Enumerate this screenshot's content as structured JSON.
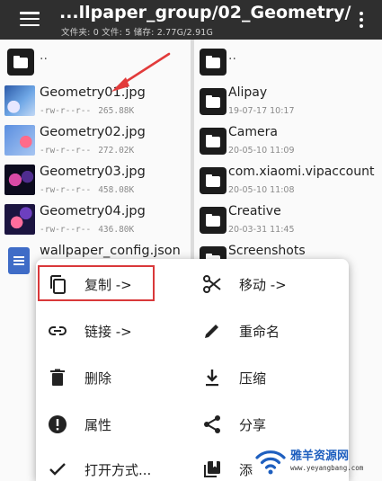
{
  "appbar": {
    "title": "...llpaper_group/02_Geometry/",
    "subtitle": "文件夹: 0   文件: 5   储存: 2.77G/2.91G"
  },
  "left_pane": {
    "parent_label": "..",
    "files": [
      {
        "name": "Geometry01.jpg",
        "perm": "-rw-r--r--",
        "size": "265.88K",
        "thumb": "t1"
      },
      {
        "name": "Geometry02.jpg",
        "perm": "-rw-r--r--",
        "size": "272.02K",
        "thumb": "t2"
      },
      {
        "name": "Geometry03.jpg",
        "perm": "-rw-r--r--",
        "size": "458.08K",
        "thumb": "t3"
      },
      {
        "name": "Geometry04.jpg",
        "perm": "-rw-r--r--",
        "size": "436.80K",
        "thumb": "t4"
      },
      {
        "name": "wallpaper_config.json",
        "perm": "",
        "size": "",
        "thumb": "doc"
      }
    ]
  },
  "right_pane": {
    "parent_label": "..",
    "folders": [
      {
        "name": "Alipay",
        "date": "19-07-17 10:17"
      },
      {
        "name": "Camera",
        "date": "20-05-10 11:09"
      },
      {
        "name": "com.xiaomi.vipaccount",
        "date": "20-05-10 11:08"
      },
      {
        "name": "Creative",
        "date": "20-03-31 11:45"
      },
      {
        "name": "Screenshots",
        "date": ""
      }
    ]
  },
  "context_menu": {
    "items": [
      {
        "label": "复制 ->",
        "icon": "copy-icon"
      },
      {
        "label": "移动 ->",
        "icon": "cut-icon"
      },
      {
        "label": "链接 ->",
        "icon": "link-icon"
      },
      {
        "label": "重命名",
        "icon": "pencil-icon"
      },
      {
        "label": "删除",
        "icon": "trash-icon"
      },
      {
        "label": "压缩",
        "icon": "download-icon"
      },
      {
        "label": "属性",
        "icon": "info-icon"
      },
      {
        "label": "分享",
        "icon": "share-icon"
      },
      {
        "label": "打开方式...",
        "icon": "check-icon"
      },
      {
        "label": "添",
        "icon": "bookmark-icon"
      }
    ]
  },
  "watermark": {
    "text": "雅羊资源网",
    "url": "www.yeyangbang.com"
  },
  "colors": {
    "appbar": "#2f2f2f",
    "highlight": "#d9383a",
    "arrow": "#e23b3b"
  }
}
